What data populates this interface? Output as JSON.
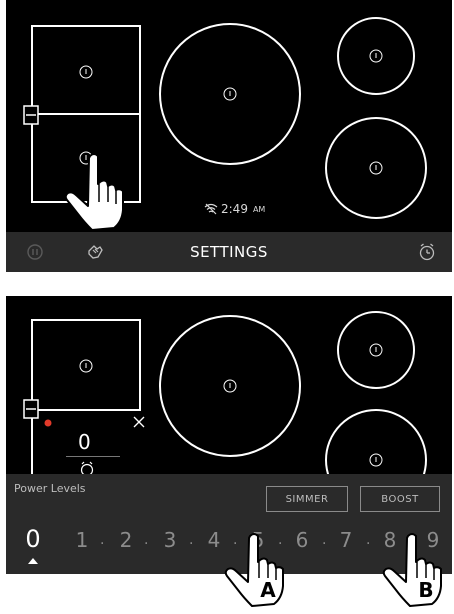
{
  "panel1": {
    "time": "2:49",
    "ampm": "AM",
    "bottom_bar": {
      "settings_label": "SETTINGS",
      "icons": [
        "pause-icon",
        "hand-lock-icon",
        "alarm-clock-icon"
      ]
    }
  },
  "panel2": {
    "zone_display_value": "0",
    "power_levels": {
      "title": "Power Levels",
      "simmer_label": "SIMMER",
      "boost_label": "BOOST",
      "levels": [
        "0",
        "1",
        "2",
        "3",
        "4",
        "5",
        "6",
        "7",
        "8",
        "9"
      ],
      "selected": "0"
    }
  },
  "callouts": {
    "a": "A",
    "b": "B"
  },
  "colors": {
    "cooktop_bg": "#000000",
    "bar_bg": "#2a2a2a",
    "ring": "#ffffff",
    "indicator_red": "#e23a2a"
  }
}
